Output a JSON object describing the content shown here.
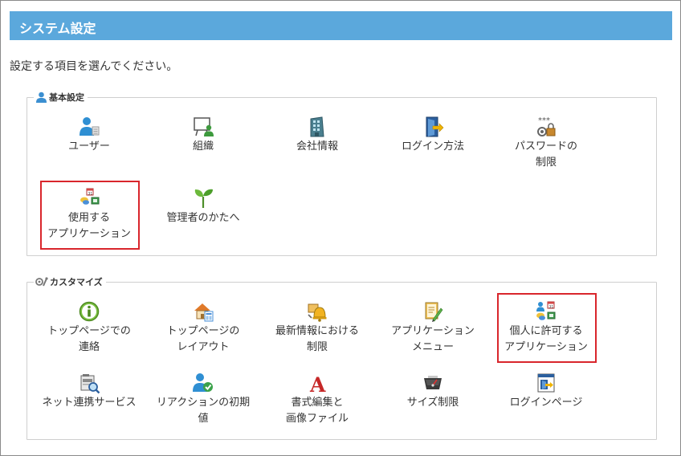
{
  "page": {
    "title": "システム設定",
    "intro": "設定する項目を選んでください。"
  },
  "basic": {
    "legend": "基本設定",
    "items": [
      {
        "label": "ユーザー",
        "icon": "user-icon"
      },
      {
        "label": "組織",
        "icon": "organization-icon"
      },
      {
        "label": "会社情報",
        "icon": "building-icon"
      },
      {
        "label": "ログイン方法",
        "icon": "login-door-icon"
      },
      {
        "label": "パスワードの\n制限",
        "icon": "password-lock-icon"
      },
      {
        "label": "使用する\nアプリケーション",
        "icon": "apps-icon"
      },
      {
        "label": "管理者のかたへ",
        "icon": "sprout-icon"
      }
    ]
  },
  "custom": {
    "legend": "カスタマイズ",
    "items": [
      {
        "label": "トップページでの\n連絡",
        "icon": "info-icon"
      },
      {
        "label": "トップページの\nレイアウト",
        "icon": "home-layout-icon"
      },
      {
        "label": "最新情報における\n制限",
        "icon": "bell-icon"
      },
      {
        "label": "アプリケーション\nメニュー",
        "icon": "menu-pen-icon"
      },
      {
        "label": "個人に許可する\nアプリケーション",
        "icon": "user-apps-icon"
      },
      {
        "label": "ネット連携サービス",
        "icon": "net-service-icon"
      },
      {
        "label": "リアクションの初期値",
        "icon": "reaction-user-icon"
      },
      {
        "label": "書式編集と\n画像ファイル",
        "icon": "format-a-icon"
      },
      {
        "label": "サイズ制限",
        "icon": "gauge-icon"
      },
      {
        "label": "ログインページ",
        "icon": "login-page-icon"
      }
    ]
  },
  "colors": {
    "header_bg": "#5ba8dc",
    "highlight": "#d9262c"
  }
}
